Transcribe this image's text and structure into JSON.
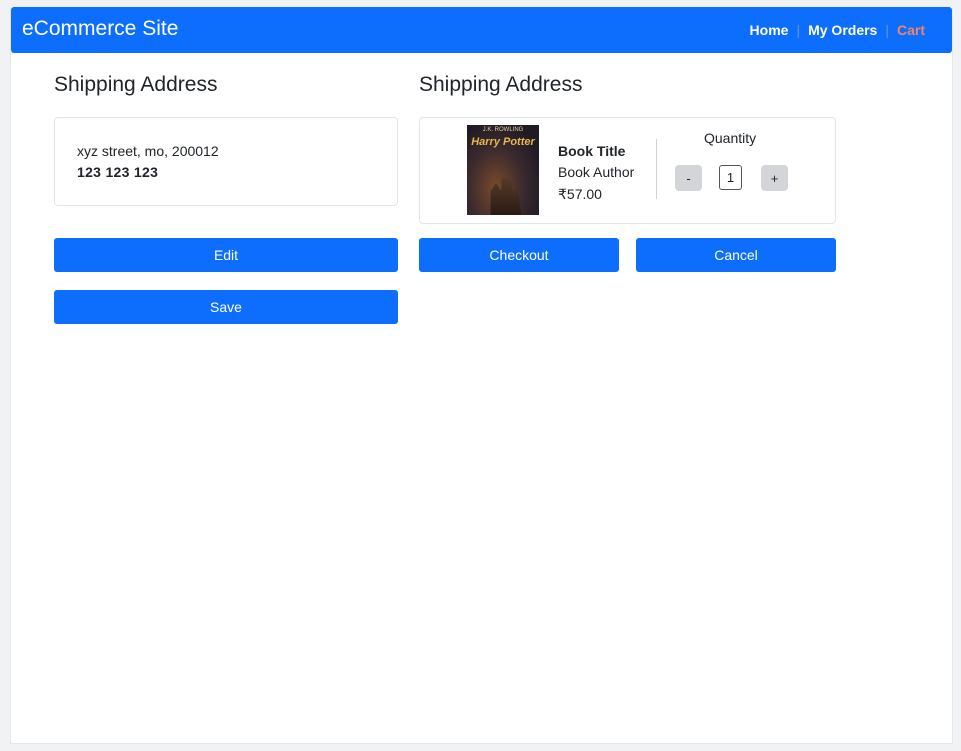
{
  "navbar": {
    "brand": "eCommerce Site",
    "links": [
      "Home",
      "My Orders",
      "Cart"
    ],
    "separator": "|",
    "bg_color": "#0d6efd",
    "active_link_color": "#f0856a"
  },
  "left": {
    "title": "Shipping Address",
    "address": "xyz street, mo, 200012",
    "phone": "123 123 123",
    "edit_label": "Edit",
    "save_label": "Save"
  },
  "right": {
    "title": "Shipping Address",
    "item": {
      "cover_author": "J.K. ROWLING",
      "cover_title": "Harry Potter",
      "title": "Book Title",
      "author": "Book Author",
      "price": "₹57.00",
      "quantity_label": "Quantity",
      "quantity": "1",
      "decrement": "-",
      "increment": "+"
    },
    "checkout_label": "Checkout",
    "cancel_label": "Cancel"
  }
}
